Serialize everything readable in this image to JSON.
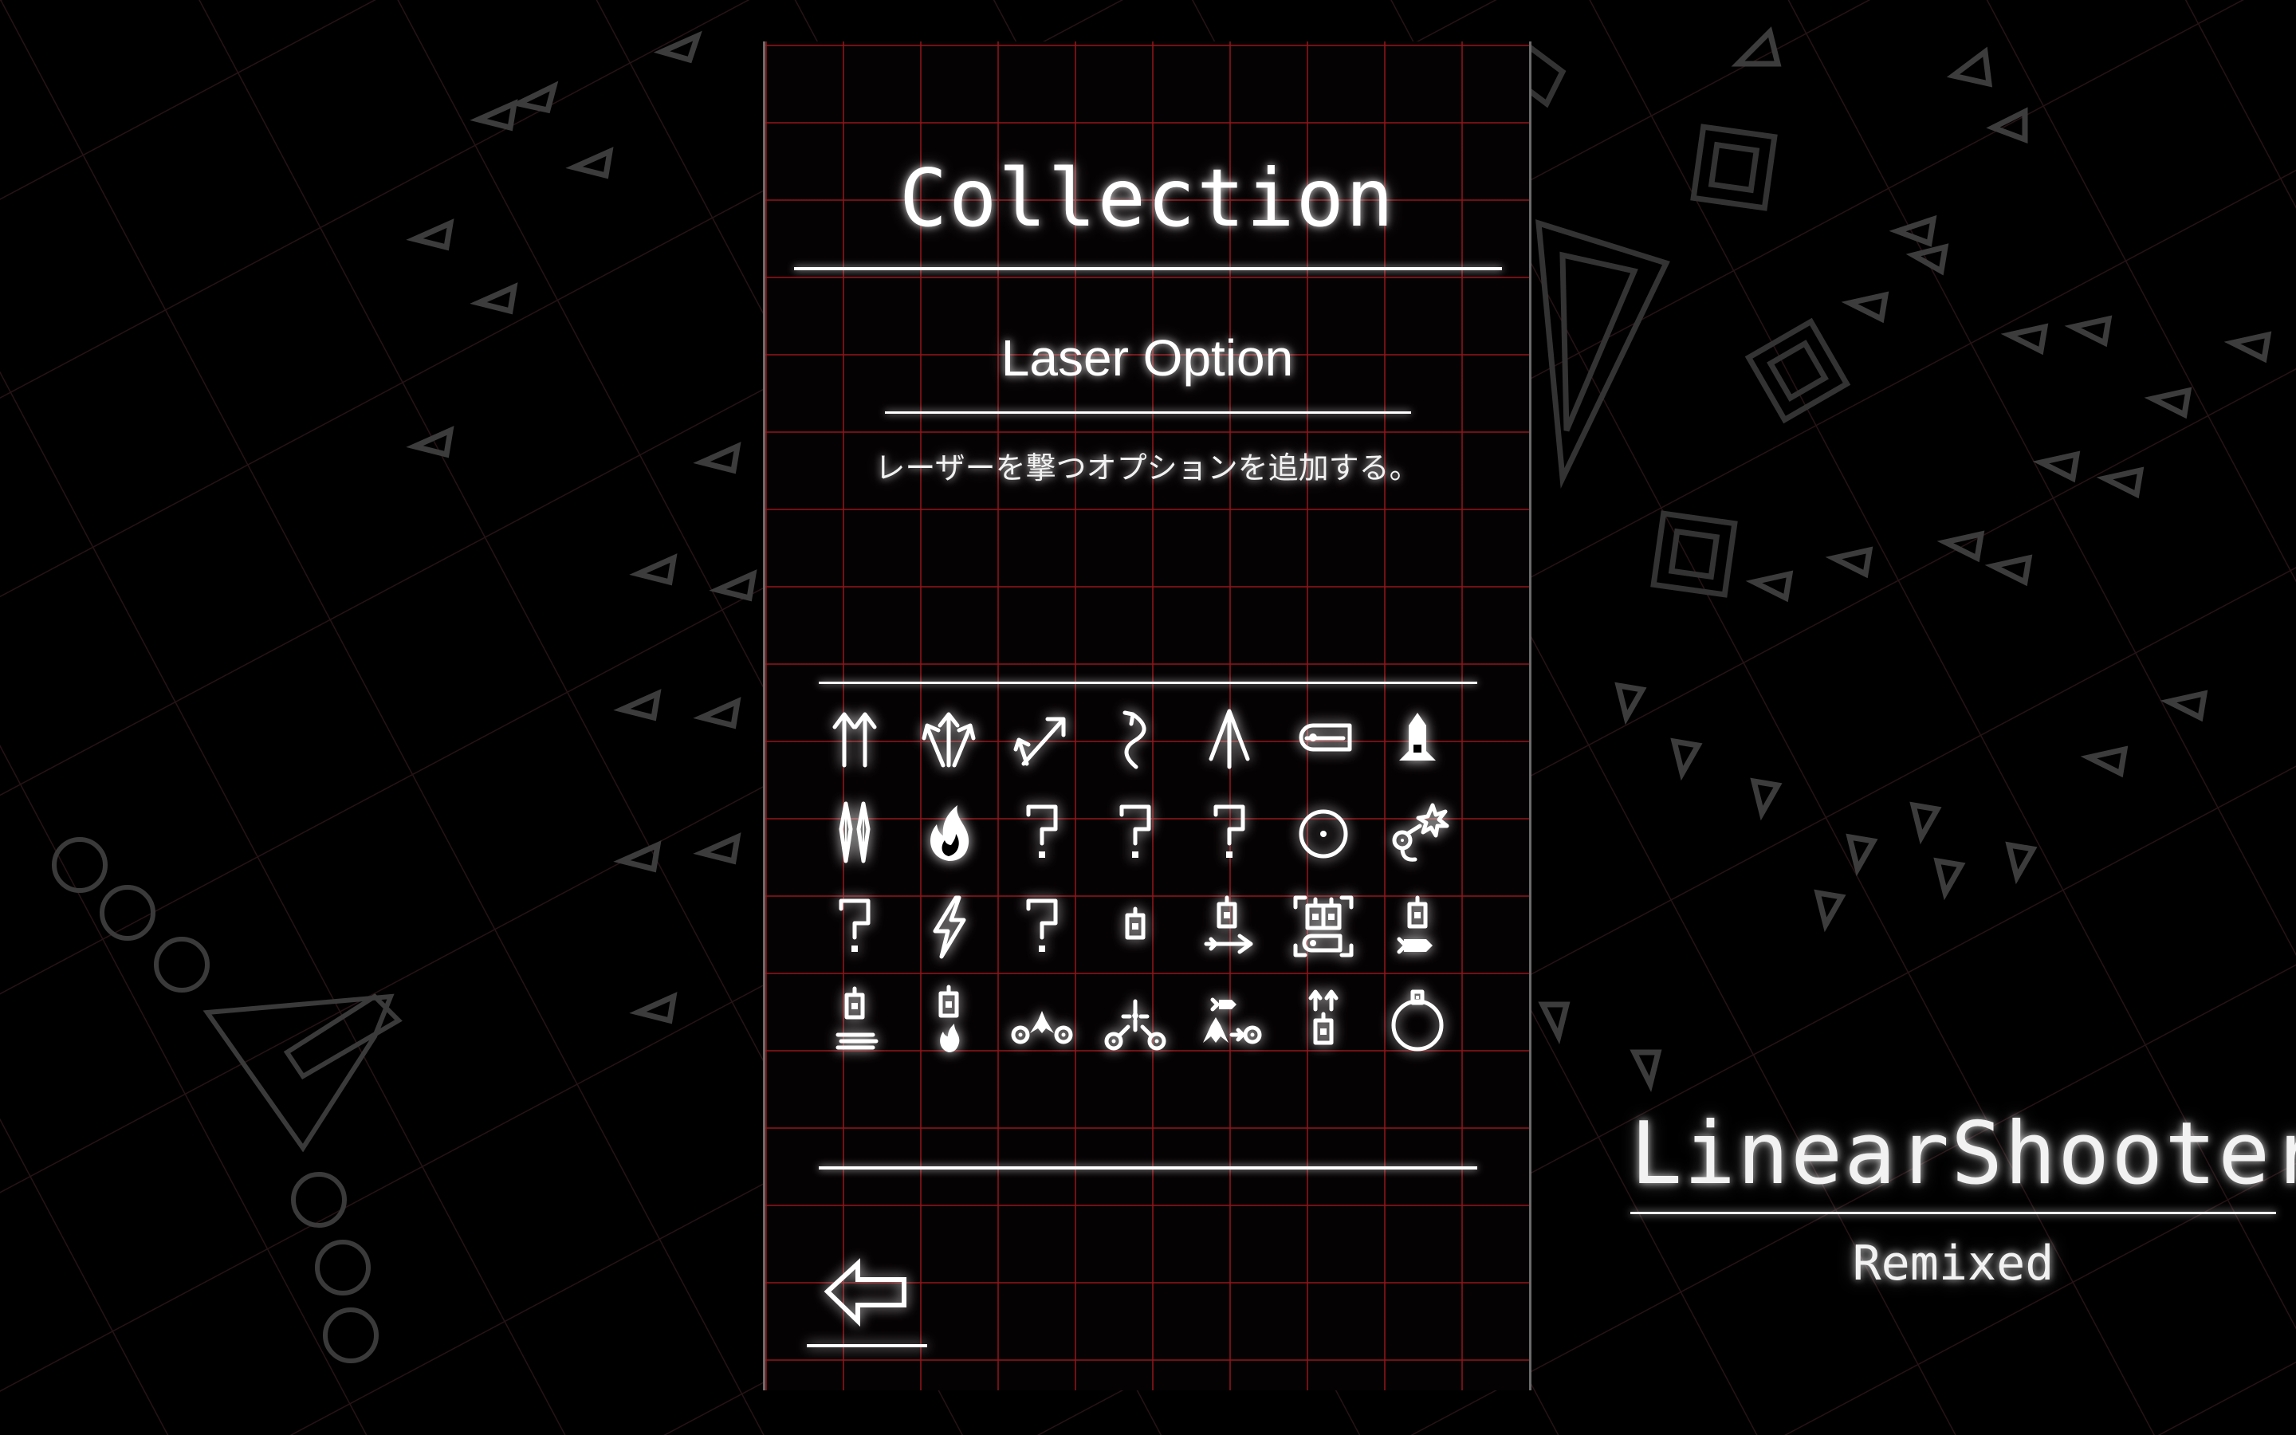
{
  "screen": {
    "title": "Collection",
    "item_name": "Laser Option",
    "item_description": "レーザーを撃つオプションを追加する。"
  },
  "grid": {
    "selected_index": 19,
    "items": [
      {
        "icon": "twin-arrows-icon"
      },
      {
        "icon": "spread-arrows-icon"
      },
      {
        "icon": "diagonal-arrows-icon"
      },
      {
        "icon": "homing-arrow-icon"
      },
      {
        "icon": "piercing-arrow-icon"
      },
      {
        "icon": "laser-capsule-icon"
      },
      {
        "icon": "rocket-ship-icon"
      },
      {
        "icon": "twin-blades-icon"
      },
      {
        "icon": "flame-icon"
      },
      {
        "icon": "unknown-icon",
        "label": "?"
      },
      {
        "icon": "unknown-icon",
        "label": "?"
      },
      {
        "icon": "unknown-icon",
        "label": "?"
      },
      {
        "icon": "ring-target-icon"
      },
      {
        "icon": "bomb-burst-icon"
      },
      {
        "icon": "unknown-icon",
        "label": "?"
      },
      {
        "icon": "lightning-icon"
      },
      {
        "icon": "unknown-icon",
        "label": "?"
      },
      {
        "icon": "option-pod-icon"
      },
      {
        "icon": "option-arrow-icon"
      },
      {
        "icon": "laser-option-icon"
      },
      {
        "icon": "option-missile-icon"
      },
      {
        "icon": "option-needles-icon"
      },
      {
        "icon": "option-flame-icon"
      },
      {
        "icon": "twin-drones-icon"
      },
      {
        "icon": "cross-drones-icon"
      },
      {
        "icon": "drone-missile-icon"
      },
      {
        "icon": "option-twin-arrows-icon"
      },
      {
        "icon": "orbit-shield-icon"
      }
    ]
  },
  "back_button": {
    "icon": "back-arrow-icon"
  },
  "logo": {
    "title": "LinearShooter",
    "subtitle": "Remixed"
  },
  "colors": {
    "grid_line": "#961419",
    "glow": "#ffffff",
    "background_shapes": "#444444"
  }
}
